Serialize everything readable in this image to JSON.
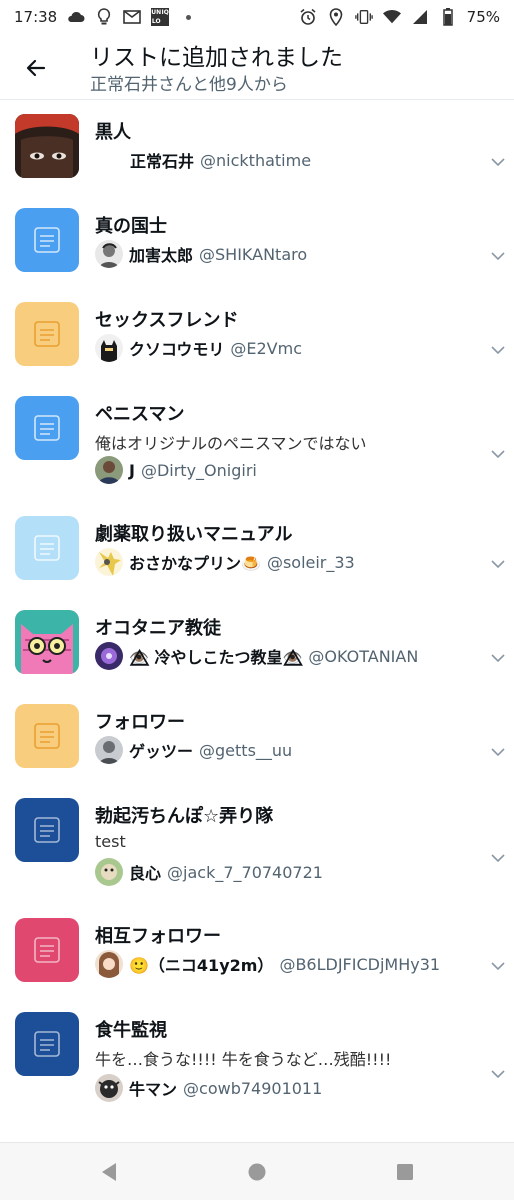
{
  "statusbar": {
    "time": "17:38",
    "battery": "75%",
    "left_icons": [
      "cloud-icon",
      "bulb-icon",
      "mail-icon",
      "uniqlo-icon",
      "dot-icon"
    ],
    "uniqlo_text": [
      "UN",
      "IQ",
      "LO",
      ""
    ],
    "right_icons": [
      "alarm-icon",
      "location-icon",
      "vibrate-icon",
      "wifi-icon",
      "signal-icon",
      "battery-icon"
    ]
  },
  "header": {
    "title": "リストに追加されました",
    "subtitle": "正常石井さんと他9人から",
    "back_icon": "arrow-left-icon"
  },
  "colors": {
    "blue": "#4a9ff0",
    "orange": "#f9cd7e",
    "lightblue": "#b3dff8",
    "navy": "#1d4f99",
    "pink": "#e04870",
    "secondary_text": "#536471",
    "chevron": "#8b98a5"
  },
  "lists": [
    {
      "name": "黒人",
      "description": "",
      "thumb": "photo",
      "thumb_icon": "face-photo-icon",
      "owner_name": "正常石井",
      "owner_handle": "@nickthatime",
      "owner_avatar": "none"
    },
    {
      "name": "真の国士",
      "description": "",
      "thumb": "blue",
      "thumb_icon": "list-icon",
      "owner_name": "加害太郎",
      "owner_handle": "@SHIKANtaro",
      "owner_avatar": "sketch"
    },
    {
      "name": "セックスフレンド",
      "description": "",
      "thumb": "orange",
      "thumb_icon": "list-icon",
      "owner_name": "クソコウモリ",
      "owner_handle": "@E2Vmc",
      "owner_avatar": "bat"
    },
    {
      "name": "ペニスマン",
      "description": "俺はオリジナルのペニスマンではない",
      "thumb": "blue",
      "thumb_icon": "list-icon",
      "owner_name": "J",
      "owner_handle": "@Dirty_Onigiri",
      "owner_avatar": "person"
    },
    {
      "name": "劇薬取り扱いマニュアル",
      "description": "",
      "thumb": "lightblue",
      "thumb_icon": "list-icon",
      "owner_name": "おさかなプリン🍮",
      "owner_handle": "@soleir_33",
      "owner_avatar": "anime"
    },
    {
      "name": "オコタニア教徒",
      "description": "",
      "thumb": "cat",
      "thumb_icon": "cat-illustration-icon",
      "owner_name": "👁️⃤ 冷やしこたつ教皇👁️⃤",
      "owner_handle": "@OKOTANIAN",
      "owner_avatar": "purple"
    },
    {
      "name": "フォロワー",
      "description": "",
      "thumb": "orange",
      "thumb_icon": "list-icon",
      "owner_name": "ゲッツー",
      "owner_handle": "@getts__uu",
      "owner_avatar": "gray"
    },
    {
      "name": "勃起汚ちんぽ☆弄り隊",
      "description": "test",
      "thumb": "navy",
      "thumb_icon": "list-icon",
      "owner_name": "良心",
      "owner_handle": "@jack_7_70740721",
      "owner_avatar": "green"
    },
    {
      "name": "相互フォロワー",
      "description": "",
      "thumb": "pink",
      "thumb_icon": "list-icon",
      "owner_name": "🙂（ニコ41y2m）",
      "owner_handle": "@B6LDJFICDjMHy31",
      "owner_avatar": "girl"
    },
    {
      "name": "食牛監視",
      "description": "牛を…食うな!!!! 牛を食うなど…残酷!!!!",
      "thumb": "navy",
      "thumb_icon": "list-icon",
      "owner_name": "牛マン",
      "owner_handle": "@cowb74901011",
      "owner_avatar": "cow"
    }
  ],
  "navbar": {
    "icons": [
      "nav-back-icon",
      "nav-home-icon",
      "nav-recents-icon"
    ]
  }
}
